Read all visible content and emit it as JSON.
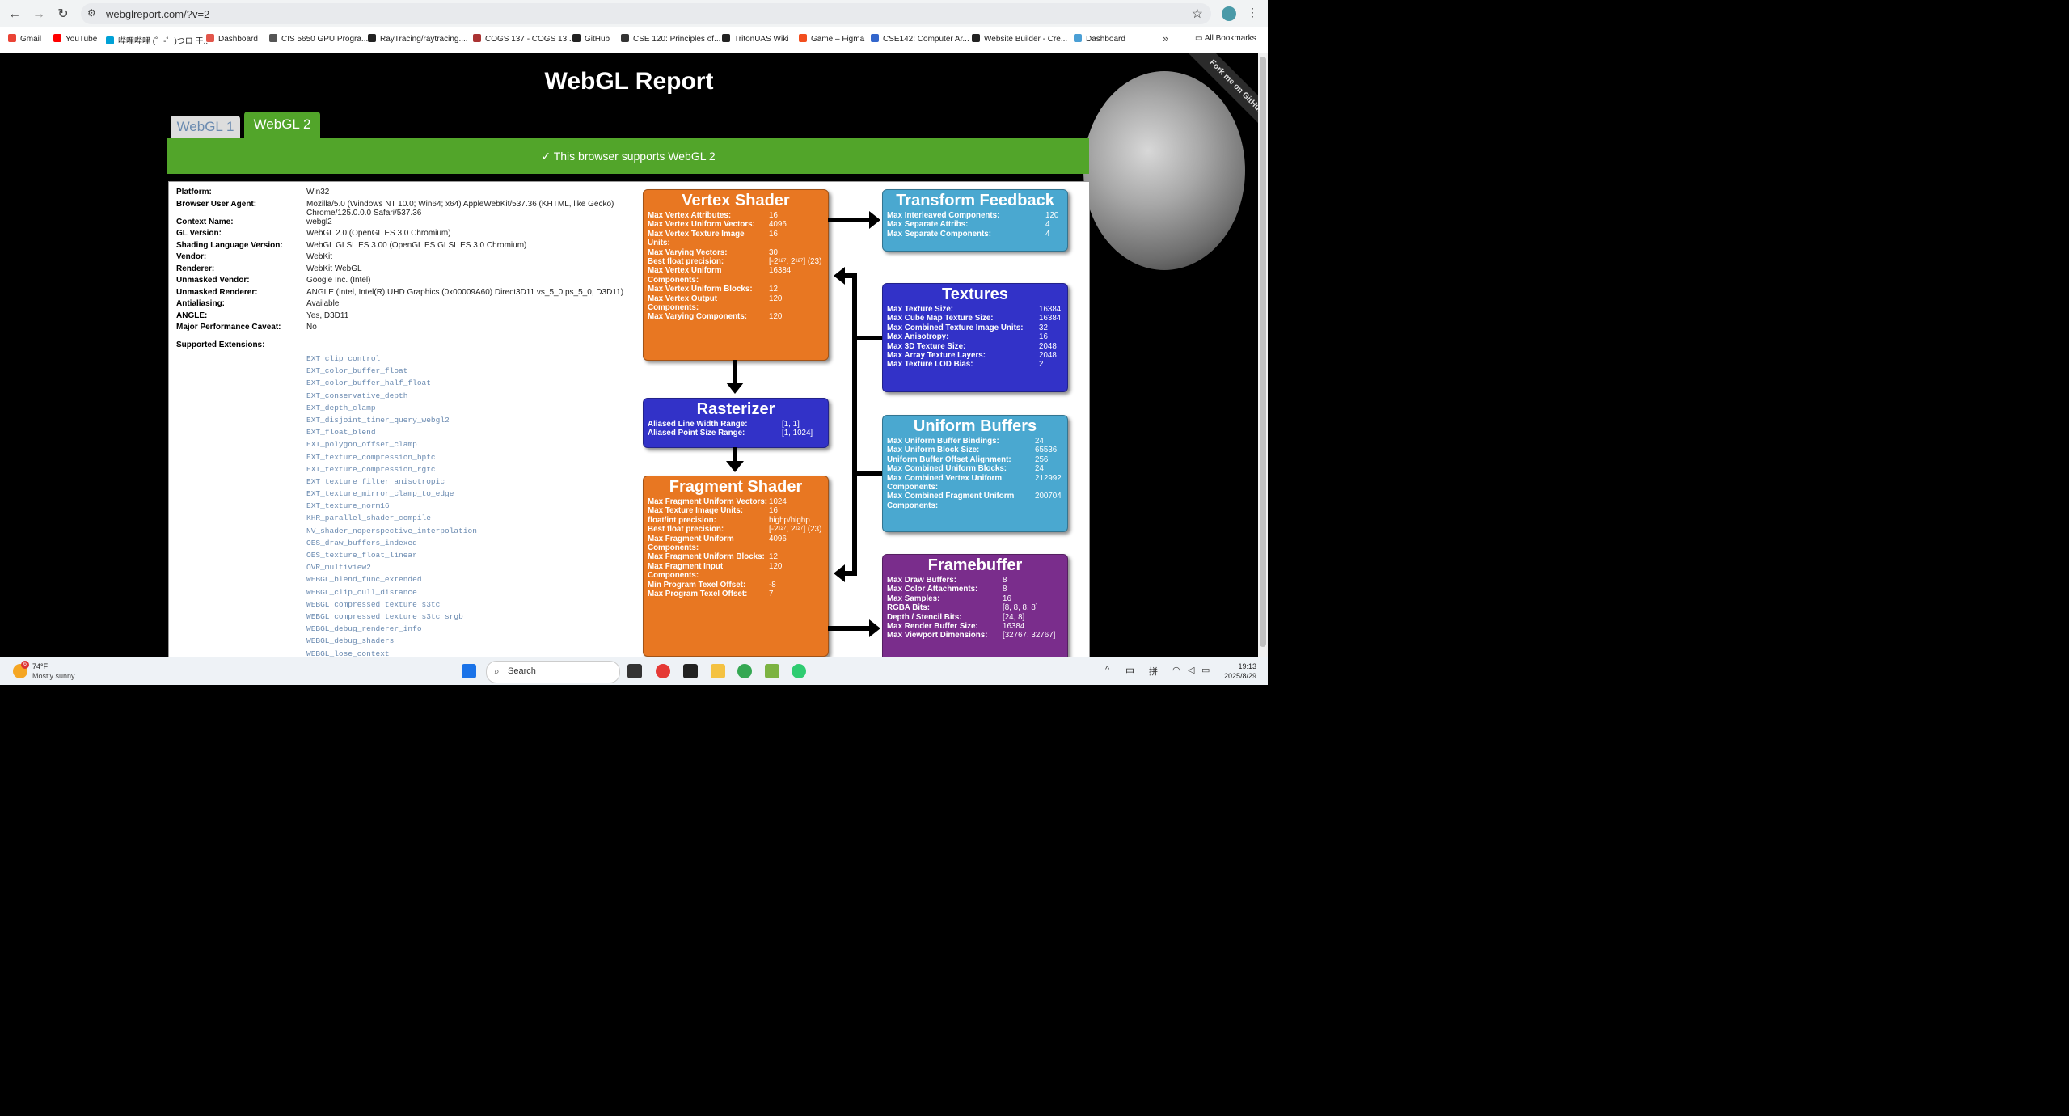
{
  "browser": {
    "url": "webglreport.com/?v=2",
    "bookmarks": [
      "Gmail",
      "YouTube",
      "哔哩哔哩 (゜-゜)つロ 干...",
      "Dashboard",
      "CIS 5650 GPU Progra...",
      "RayTracing/raytracing....",
      "COGS 137 - COGS 13...",
      "GitHub",
      "CSE 120: Principles of...",
      "TritonUAS Wiki",
      "Game – Figma",
      "CSE142: Computer Ar...",
      "Website Builder - Cre...",
      "Dashboard"
    ],
    "all_bookmarks": "All Bookmarks"
  },
  "page": {
    "title": "WebGL Report",
    "fork": "Fork me on GitHub",
    "tab1": "WebGL 1",
    "tab2": "WebGL 2",
    "support": "✓ This browser supports WebGL 2"
  },
  "info": [
    {
      "k": "Platform:",
      "v": "Win32"
    },
    {
      "k": "Browser User Agent:",
      "v": "Mozilla/5.0 (Windows NT 10.0; Win64; x64) AppleWebKit/537.36 (KHTML, like Gecko) Chrome/125.0.0.0 Safari/537.36"
    },
    {
      "k": "Context Name:",
      "v": "webgl2"
    },
    {
      "k": "GL Version:",
      "v": "WebGL 2.0 (OpenGL ES 3.0 Chromium)"
    },
    {
      "k": "Shading Language Version:",
      "v": "WebGL GLSL ES 3.00 (OpenGL ES GLSL ES 3.0 Chromium)"
    },
    {
      "k": "Vendor:",
      "v": "WebKit"
    },
    {
      "k": "Renderer:",
      "v": "WebKit WebGL"
    },
    {
      "k": "Unmasked Vendor:",
      "v": "Google Inc. (Intel)"
    },
    {
      "k": "Unmasked Renderer:",
      "v": "ANGLE (Intel, Intel(R) UHD Graphics (0x00009A60) Direct3D11 vs_5_0 ps_5_0, D3D11)"
    },
    {
      "k": "Antialiasing:",
      "v": "Available"
    },
    {
      "k": "ANGLE:",
      "v": "Yes, D3D11"
    },
    {
      "k": "Major Performance Caveat:",
      "v": "No"
    }
  ],
  "extensions_label": "Supported Extensions:",
  "extensions": [
    "EXT_clip_control",
    "EXT_color_buffer_float",
    "EXT_color_buffer_half_float",
    "EXT_conservative_depth",
    "EXT_depth_clamp",
    "EXT_disjoint_timer_query_webgl2",
    "EXT_float_blend",
    "EXT_polygon_offset_clamp",
    "EXT_texture_compression_bptc",
    "EXT_texture_compression_rgtc",
    "EXT_texture_filter_anisotropic",
    "EXT_texture_mirror_clamp_to_edge",
    "EXT_texture_norm16",
    "KHR_parallel_shader_compile",
    "NV_shader_noperspective_interpolation",
    "OES_draw_buffers_indexed",
    "OES_texture_float_linear",
    "OVR_multiview2",
    "WEBGL_blend_func_extended",
    "WEBGL_clip_cull_distance",
    "WEBGL_compressed_texture_s3tc",
    "WEBGL_compressed_texture_s3tc_srgb",
    "WEBGL_debug_renderer_info",
    "WEBGL_debug_shaders",
    "WEBGL_lose_context"
  ],
  "boxes": {
    "vertex": {
      "title": "Vertex Shader",
      "rows": [
        {
          "k": "Max Vertex Attributes:",
          "v": "16"
        },
        {
          "k": "Max Vertex Uniform Vectors:",
          "v": "4096"
        },
        {
          "k": "Max Vertex Texture Image Units:",
          "v": "16"
        },
        {
          "k": "Max Varying Vectors:",
          "v": "30"
        },
        {
          "k": "Best float precision:",
          "v": "[-2¹²⁷, 2¹²⁷] (23)"
        },
        {
          "k": "Max Vertex Uniform Components:",
          "v": "16384"
        },
        {
          "k": "Max Vertex Uniform Blocks:",
          "v": "12"
        },
        {
          "k": "Max Vertex Output Components:",
          "v": "120"
        },
        {
          "k": "Max Varying Components:",
          "v": "120"
        }
      ]
    },
    "rasterizer": {
      "title": "Rasterizer",
      "rows": [
        {
          "k": "Aliased Line Width Range:",
          "v": "[1, 1]"
        },
        {
          "k": "Aliased Point Size Range:",
          "v": "[1, 1024]"
        }
      ]
    },
    "fragment": {
      "title": "Fragment Shader",
      "rows": [
        {
          "k": "Max Fragment Uniform Vectors:",
          "v": "1024"
        },
        {
          "k": "Max Texture Image Units:",
          "v": "16"
        },
        {
          "k": "float/int precision:",
          "v": "highp/highp"
        },
        {
          "k": "Best float precision:",
          "v": "[-2¹²⁷, 2¹²⁷] (23)"
        },
        {
          "k": "Max Fragment Uniform Components:",
          "v": "4096"
        },
        {
          "k": "Max Fragment Uniform Blocks:",
          "v": "12"
        },
        {
          "k": "Max Fragment Input Components:",
          "v": "120"
        },
        {
          "k": "Min Program Texel Offset:",
          "v": "-8"
        },
        {
          "k": "Max Program Texel Offset:",
          "v": "7"
        }
      ]
    },
    "transform": {
      "title": "Transform Feedback",
      "rows": [
        {
          "k": "Max Interleaved Components:",
          "v": "120"
        },
        {
          "k": "Max Separate Attribs:",
          "v": "4"
        },
        {
          "k": "Max Separate Components:",
          "v": "4"
        }
      ]
    },
    "textures": {
      "title": "Textures",
      "rows": [
        {
          "k": "Max Texture Size:",
          "v": "16384"
        },
        {
          "k": "Max Cube Map Texture Size:",
          "v": "16384"
        },
        {
          "k": "Max Combined Texture Image Units:",
          "v": "32"
        },
        {
          "k": "Max Anisotropy:",
          "v": "16"
        },
        {
          "k": "Max 3D Texture Size:",
          "v": "2048"
        },
        {
          "k": "Max Array Texture Layers:",
          "v": "2048"
        },
        {
          "k": "Max Texture LOD Bias:",
          "v": "2"
        }
      ]
    },
    "uniform": {
      "title": "Uniform Buffers",
      "rows": [
        {
          "k": "Max Uniform Buffer Bindings:",
          "v": "24"
        },
        {
          "k": "Max Uniform Block Size:",
          "v": "65536"
        },
        {
          "k": "Uniform Buffer Offset Alignment:",
          "v": "256"
        },
        {
          "k": "Max Combined Uniform Blocks:",
          "v": "24"
        },
        {
          "k": "Max Combined Vertex Uniform Components:",
          "v": "212992"
        },
        {
          "k": "Max Combined Fragment Uniform Components:",
          "v": "200704"
        }
      ]
    },
    "framebuffer": {
      "title": "Framebuffer",
      "rows": [
        {
          "k": "Max Draw Buffers:",
          "v": "8"
        },
        {
          "k": "Max Color Attachments:",
          "v": "8"
        },
        {
          "k": "Max Samples:",
          "v": "16"
        },
        {
          "k": "RGBA Bits:",
          "v": "[8, 8, 8, 8]"
        },
        {
          "k": "Depth / Stencil Bits:",
          "v": "[24, 8]"
        },
        {
          "k": "Max Render Buffer Size:",
          "v": "16384"
        },
        {
          "k": "Max Viewport Dimensions:",
          "v": "[32767, 32767]"
        }
      ]
    }
  },
  "taskbar": {
    "temp": "74°F",
    "weather": "Mostly sunny",
    "weather_badge": "6",
    "search": "Search",
    "ime": "中",
    "ime2": "拼",
    "time": "19:13",
    "date": "2025/8/29"
  }
}
